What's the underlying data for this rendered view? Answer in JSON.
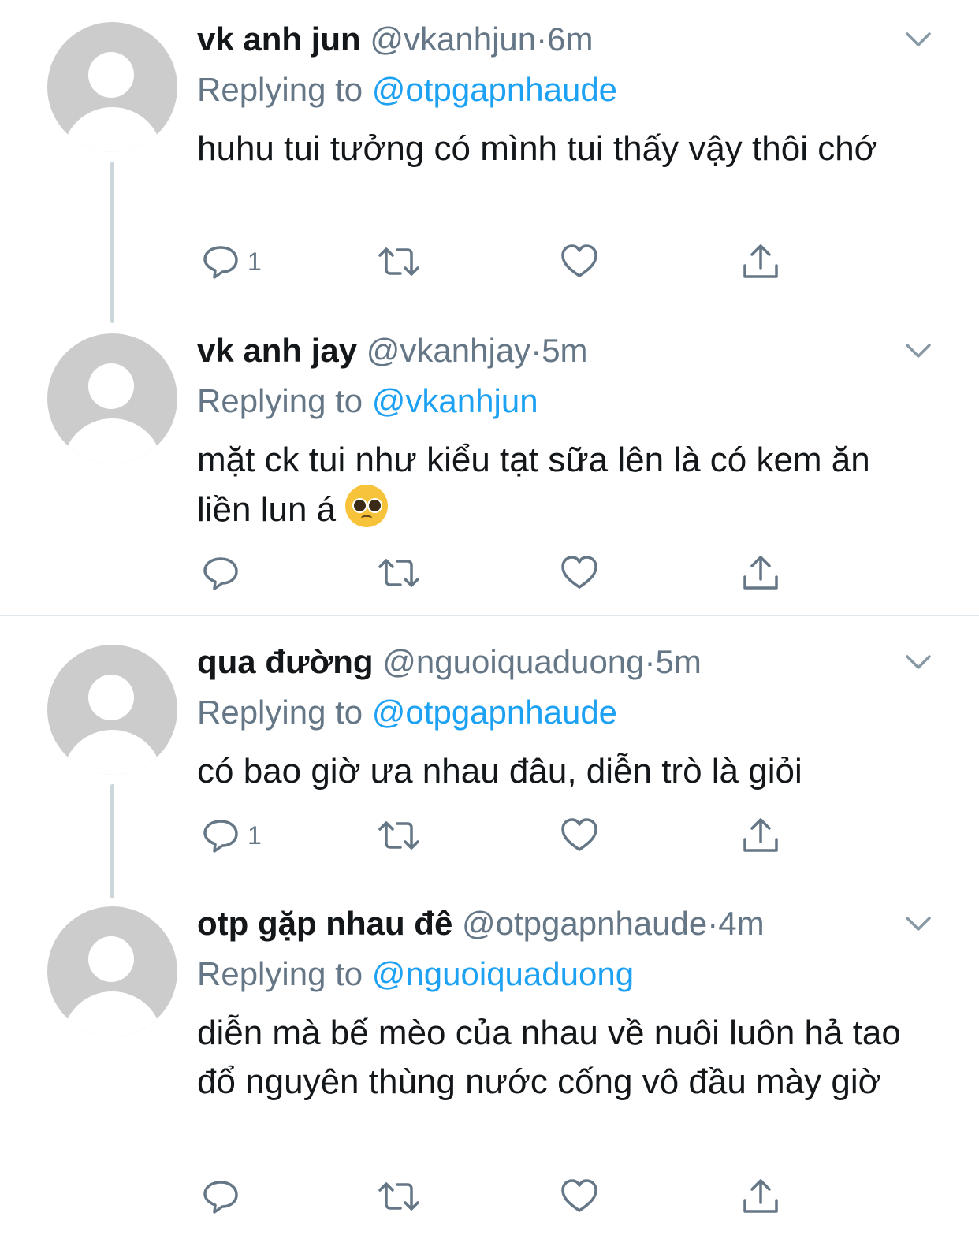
{
  "tweets": [
    {
      "name": "vk anh jun",
      "handle": "@vkanhjun",
      "dot": "·",
      "time": "6m",
      "replying_label": "Replying to",
      "replying_to": "@otpgapnhaude",
      "text": "huhu tui tưởng có mình tui thấy vậy thôi chớ",
      "reply_count": "1"
    },
    {
      "name": "vk anh jay",
      "handle": "@vkanhjay",
      "dot": "·",
      "time": "5m",
      "replying_label": "Replying to",
      "replying_to": "@vkanhjun",
      "text": "mặt ck tui như kiểu tạt sữa lên là có kem ăn liền lun á",
      "emoji": "pleading-face-emoji",
      "reply_count": ""
    },
    {
      "name": "qua đường",
      "handle": "@nguoiquaduong",
      "dot": "·",
      "time": "5m",
      "replying_label": "Replying to",
      "replying_to": "@otpgapnhaude",
      "text": "có bao giờ ưa nhau đâu, diễn trò là giỏi",
      "reply_count": "1"
    },
    {
      "name": "otp gặp nhau đê",
      "handle": "@otpgapnhaude",
      "dot": "·",
      "time": "4m",
      "replying_label": "Replying to",
      "replying_to": "@nguoiquaduong",
      "text": "diễn mà bế mèo của nhau về nuôi luôn hả tao đổ nguyên thùng nước cống vô đầu mày giờ",
      "reply_count": ""
    }
  ],
  "icons": {
    "reply": "reply-icon",
    "retweet": "retweet-icon",
    "like": "heart-icon",
    "share": "share-icon",
    "more": "chevron-down-icon"
  },
  "colors": {
    "text": "#14171a",
    "secondary": "#657786",
    "link": "#1da1f2",
    "avatar": "#cccccc",
    "thread_line": "#ccd6dd",
    "divider": "#e1e8ed"
  }
}
